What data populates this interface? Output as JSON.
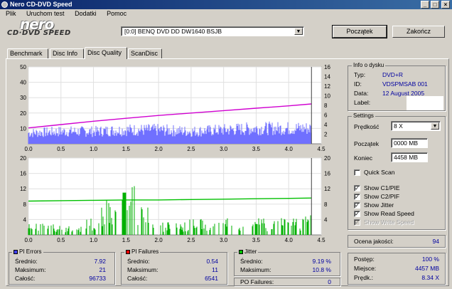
{
  "window": {
    "title": "Nero CD-DVD Speed",
    "minimize": "_",
    "maximize": "□",
    "close": "×"
  },
  "menu": [
    "Plik",
    "Uruchom test",
    "Dodatki",
    "Pomoc"
  ],
  "logo": {
    "brand": "nero",
    "sub": "CD·DVD SPEED"
  },
  "drive": {
    "value": "[0:0]  BENQ DVD DD DW1640 BSJB"
  },
  "buttons": {
    "start": "Początek",
    "end": "Zakończ"
  },
  "tabs": [
    "Benchmark",
    "Disc Info",
    "Disc Quality",
    "ScanDisc"
  ],
  "active_tab": "Disc Quality",
  "disc_info": {
    "title": "Info o dysku",
    "rows": [
      {
        "label": "Typ:",
        "value": "DVD+R"
      },
      {
        "label": "ID:",
        "value": "VDSPMSAB 001"
      },
      {
        "label": "Data:",
        "value": "12 August 2005"
      },
      {
        "label": "Label:",
        "value": ""
      }
    ]
  },
  "settings": {
    "title": "Settings",
    "speed_label": "Prędkość",
    "speed_value": "8 X",
    "start_label": "Początek",
    "start_value": "0000 MB",
    "end_label": "Koniec",
    "end_value": "4458 MB",
    "checkboxes": [
      {
        "label": "Quick Scan",
        "checked": false,
        "enabled": true
      },
      {
        "label": "Show C1/PIE",
        "checked": true,
        "enabled": true
      },
      {
        "label": "Show C2/PIF",
        "checked": true,
        "enabled": true
      },
      {
        "label": "Show Jitter",
        "checked": true,
        "enabled": true
      },
      {
        "label": "Show Read Speed",
        "checked": true,
        "enabled": true
      },
      {
        "label": "Show Write Speed",
        "checked": true,
        "enabled": false
      }
    ]
  },
  "quality": {
    "label": "Ocena jakości:",
    "value": "94"
  },
  "progress": {
    "rows": [
      {
        "label": "Postęp:",
        "value": "100 %"
      },
      {
        "label": "Miejsce:",
        "value": "4457 MB"
      },
      {
        "label": "Prędk.:",
        "value": "8.34 X"
      }
    ]
  },
  "pi_errors": {
    "title": "PI Errors",
    "color": "#4040ff",
    "rows": [
      {
        "label": "Średnio:",
        "value": "7.92"
      },
      {
        "label": "Maksimum:",
        "value": "21"
      },
      {
        "label": "Całość:",
        "value": "96733"
      }
    ]
  },
  "pi_failures": {
    "title": "PI Failures",
    "color": "#ff0000",
    "rows": [
      {
        "label": "Średnio:",
        "value": "0.54"
      },
      {
        "label": "Maksimum:",
        "value": "11"
      },
      {
        "label": "Całość:",
        "value": "6541"
      }
    ]
  },
  "jitter": {
    "title": "Jitter",
    "color": "#00c000",
    "rows": [
      {
        "label": "Średnio:",
        "value": "9.19 %"
      },
      {
        "label": "Maksimum:",
        "value": "10.8 %"
      }
    ],
    "po_label": "PO Failures:",
    "po_value": "0"
  },
  "chart_data": [
    {
      "type": "area",
      "name": "PI Errors / Read speed",
      "x_ticks": [
        "0.0",
        "0.5",
        "1.0",
        "1.5",
        "2.0",
        "2.5",
        "3.0",
        "3.5",
        "4.0",
        "4.5"
      ],
      "y_left_ticks": [
        "50",
        "40",
        "30",
        "20",
        "10"
      ],
      "y_right_ticks": [
        "16",
        "14",
        "12",
        "10",
        "8",
        "6",
        "4",
        "2"
      ],
      "xlim": [
        0,
        4.5
      ],
      "ylim_left": [
        0,
        50
      ],
      "ylim_right": [
        0,
        16
      ],
      "series": [
        {
          "name": "PI Errors",
          "color": "#7070ff",
          "x": [
            0.0,
            0.5,
            1.0,
            1.5,
            2.0,
            2.5,
            3.0,
            3.5,
            4.0,
            4.35
          ],
          "y": [
            7,
            8,
            8,
            9,
            9,
            8,
            9,
            10,
            10,
            10
          ]
        },
        {
          "name": "Read speed",
          "color": "#d000d0",
          "x": [
            0.0,
            0.5,
            1.0,
            1.5,
            2.0,
            2.5,
            3.0,
            3.5,
            4.0,
            4.35
          ],
          "y": [
            3.3,
            4.0,
            4.7,
            5.3,
            5.9,
            6.4,
            6.9,
            7.4,
            7.9,
            8.3
          ]
        }
      ]
    },
    {
      "type": "bar",
      "name": "PI Failures / Jitter",
      "x_ticks": [
        "0.0",
        "0.5",
        "1.0",
        "1.5",
        "2.0",
        "2.5",
        "3.0",
        "3.5",
        "4.0",
        "4.5"
      ],
      "y_left_ticks": [
        "20",
        "16",
        "12",
        "8",
        "4"
      ],
      "y_right_ticks": [
        "20",
        "16",
        "12",
        "8",
        "4"
      ],
      "xlim": [
        0,
        4.5
      ],
      "ylim_left": [
        0,
        20
      ],
      "ylim_right": [
        0,
        20
      ],
      "series": [
        {
          "name": "PI Failures",
          "color": "#00b000",
          "x": [
            0.0,
            0.5,
            1.0,
            1.5,
            2.0,
            2.5,
            3.0,
            3.5,
            4.0,
            4.35
          ],
          "y": [
            2,
            2,
            3,
            11,
            2,
            3,
            3,
            3,
            3,
            4
          ]
        },
        {
          "name": "Jitter",
          "color": "#00c000",
          "x": [
            0.0,
            0.5,
            1.0,
            1.5,
            2.0,
            2.5,
            3.0,
            3.5,
            4.0,
            4.35
          ],
          "y": [
            8.8,
            8.9,
            9.0,
            9.1,
            9.1,
            9.2,
            9.3,
            9.4,
            9.5,
            9.6
          ]
        }
      ]
    }
  ]
}
